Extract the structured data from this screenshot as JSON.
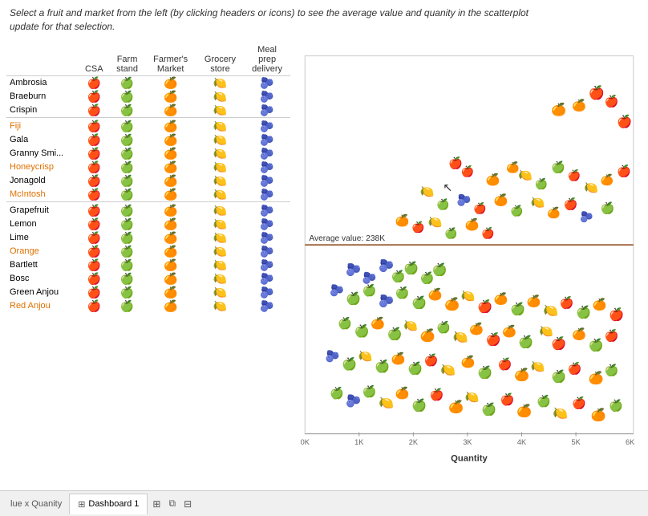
{
  "instruction": "Select a fruit and market from the left (by clicking  headers or icons) to see the average value and quanity in the scatterplot update for that selection.",
  "table": {
    "headers": [
      "CSA",
      "Farm stand",
      "Farmer's Market",
      "Grocery store",
      "Meal prep delivery"
    ],
    "fruits": [
      {
        "name": "Ambrosia",
        "style": "normal"
      },
      {
        "name": "Braeburn",
        "style": "normal"
      },
      {
        "name": "Crispin",
        "style": "normal"
      },
      {
        "name": "Fiji",
        "style": "orange"
      },
      {
        "name": "Gala",
        "style": "normal"
      },
      {
        "name": "Granny Smi...",
        "style": "normal"
      },
      {
        "name": "Honeycrisp",
        "style": "orange"
      },
      {
        "name": "Jonagold",
        "style": "normal"
      },
      {
        "name": "McIntosh",
        "style": "orange"
      },
      {
        "name": "Grapefruit",
        "style": "normal"
      },
      {
        "name": "Lemon",
        "style": "normal"
      },
      {
        "name": "Lime",
        "style": "normal"
      },
      {
        "name": "Orange",
        "style": "orange"
      },
      {
        "name": "Bartlett",
        "style": "normal"
      },
      {
        "name": "Bosc",
        "style": "normal"
      },
      {
        "name": "Green Anjou",
        "style": "normal"
      },
      {
        "name": "Red Anjou",
        "style": "orange"
      }
    ]
  },
  "scatter": {
    "avg_label": "Average value: 238K",
    "x_axis_label": "Quantity",
    "x_ticks": [
      "0K",
      "1K",
      "2K",
      "3K",
      "4K",
      "5K",
      "6K"
    ]
  },
  "tabs": {
    "inactive_tab": "lue x Quanity",
    "active_tab": "Dashboard 1"
  },
  "colors": {
    "teal": "#2ab3c8",
    "green": "#2a8c2a",
    "orange": "#e07000",
    "yellow": "#d4b800",
    "dark_blue": "#1a3a5c",
    "red_orange": "#e03030"
  }
}
